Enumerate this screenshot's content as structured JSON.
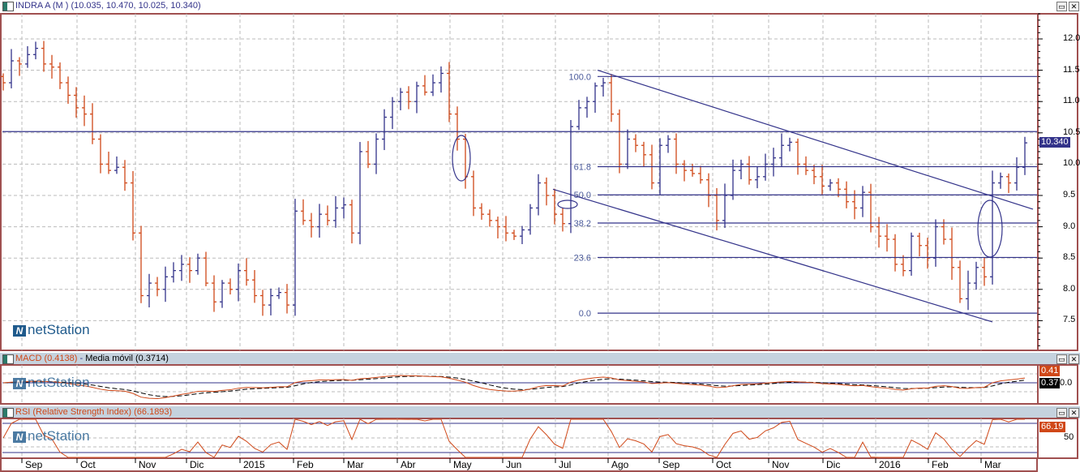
{
  "main": {
    "title": "INDRA A (M ) (10.035, 10.470, 10.025, 10.340)",
    "last_price_tag": "10.340",
    "y_ticks": [
      "12.0",
      "11.5",
      "11.0",
      "10.5",
      "10.0",
      "9.5",
      "9.0",
      "8.5",
      "8.0",
      "7.5"
    ],
    "logo": "netStation"
  },
  "macd": {
    "title": "MACD (0.4138)",
    "signal_title": "Media móvil (0.3714)",
    "tag_macd": "0.41",
    "tag_signal": "0.37",
    "y_tick": "0.0"
  },
  "rsi": {
    "title": "RSI (Relative Strength Index) (66.1893)",
    "tag": "66.19",
    "y_tick": "50"
  },
  "window_buttons": {
    "restore": "▭",
    "close": "✕"
  },
  "colors": {
    "up": "#33338a",
    "down": "#d04818",
    "frame": "#a05050",
    "header": "#c5d2de",
    "line": "#33338a"
  },
  "chart_data": {
    "type": "ohlc",
    "title": "INDRA A (M )",
    "ylim": [
      7.1,
      12.45
    ],
    "hline": 10.52,
    "closes": [
      11.3,
      11.65,
      11.6,
      11.75,
      11.85,
      11.6,
      11.55,
      11.3,
      11.1,
      10.9,
      10.8,
      10.4,
      10.0,
      9.9,
      9.95,
      9.7,
      8.9,
      7.9,
      8.1,
      8.0,
      8.2,
      8.3,
      8.4,
      8.3,
      8.5,
      8.1,
      7.8,
      8.1,
      8.0,
      8.3,
      8.15,
      7.9,
      7.75,
      7.9,
      7.95,
      7.75,
      9.25,
      9.1,
      9.0,
      9.2,
      9.1,
      9.3,
      9.35,
      8.9,
      10.2,
      10.0,
      10.4,
      10.75,
      11.0,
      11.15,
      11.0,
      11.25,
      11.15,
      11.3,
      11.45,
      10.8,
      10.4,
      9.8,
      9.3,
      9.2,
      9.1,
      9.0,
      8.9,
      8.85,
      8.95,
      9.3,
      9.7,
      9.5,
      9.2,
      9.05,
      10.6,
      10.9,
      11.0,
      11.25,
      11.3,
      10.8,
      10.0,
      10.4,
      10.3,
      10.15,
      9.7,
      10.3,
      10.4,
      10.0,
      9.9,
      9.85,
      9.75,
      9.5,
      9.1,
      9.5,
      9.9,
      10.0,
      9.75,
      9.8,
      10.0,
      10.1,
      10.3,
      10.35,
      10.0,
      9.9,
      9.8,
      9.65,
      9.7,
      9.6,
      9.4,
      9.3,
      9.55,
      9.0,
      8.85,
      8.8,
      8.4,
      8.3,
      8.85,
      8.7,
      8.5,
      9.0,
      8.8,
      8.35,
      7.85,
      8.1,
      8.35,
      8.2,
      9.7,
      9.8,
      9.7,
      9.95,
      10.34
    ],
    "x_ticks": [
      {
        "label": "Sep",
        "index": 2.3
      },
      {
        "label": "Oct",
        "index": 9.1
      },
      {
        "label": "Nov",
        "index": 16.3
      },
      {
        "label": "Dic",
        "index": 22.6
      },
      {
        "label": "2015",
        "index": 29.2
      },
      {
        "label": "Feb",
        "index": 35.8
      },
      {
        "label": "Mar",
        "index": 42
      },
      {
        "label": "Abr",
        "index": 48.6
      },
      {
        "label": "May",
        "index": 55.1
      },
      {
        "label": "Jun",
        "index": 61.6
      },
      {
        "label": "Jul",
        "index": 68.1
      },
      {
        "label": "Ago",
        "index": 74.6
      },
      {
        "label": "Sep",
        "index": 80.9
      },
      {
        "label": "Oct",
        "index": 87.5
      },
      {
        "label": "Nov",
        "index": 94.4
      },
      {
        "label": "Dic",
        "index": 101.1
      },
      {
        "label": "2016",
        "index": 107.6
      },
      {
        "label": "Feb",
        "index": 114.1
      },
      {
        "label": "Mar",
        "index": 120.6
      }
    ],
    "fibonacci": {
      "start_index": 73.3,
      "end_index": 126.5,
      "high": 11.4,
      "low": 7.62,
      "levels": [
        {
          "label": "100.0",
          "value": 11.4
        },
        {
          "label": "61.8",
          "value": 9.96
        },
        {
          "label": "50.0",
          "value": 9.51
        },
        {
          "label": "38.2",
          "value": 9.06
        },
        {
          "label": "23.6",
          "value": 8.51
        },
        {
          "label": "0.0",
          "value": 7.62
        }
      ]
    },
    "trendlines": [
      {
        "name": "channel-upper",
        "from": [
          73.3,
          11.5
        ],
        "to": [
          127,
          9.28
        ]
      },
      {
        "name": "channel-lower",
        "from": [
          67.8,
          9.6
        ],
        "to": [
          122,
          7.48
        ]
      }
    ],
    "macd_range": [
      -1.0,
      0.95
    ],
    "rsi_levels": [
      70,
      30
    ]
  }
}
